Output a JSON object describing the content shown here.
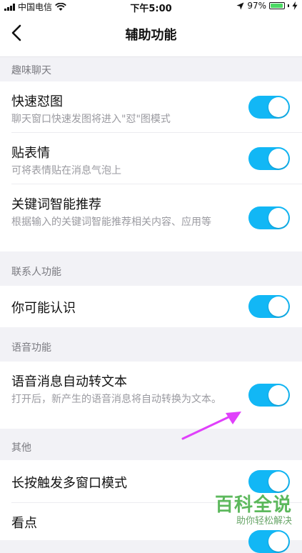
{
  "status_bar": {
    "carrier": "中国电信",
    "time": "下午5:00",
    "battery": "97%",
    "battery_level": 0.97
  },
  "nav": {
    "title": "辅助功能"
  },
  "sections": [
    {
      "header": "趣味聊天",
      "items": [
        {
          "title": "快速怼图",
          "subtitle": "聊天窗口快速发图将进入\"怼\"图模式",
          "enabled": true
        },
        {
          "title": "贴表情",
          "subtitle": "可将表情贴在消息气泡上",
          "enabled": true
        },
        {
          "title": "关键词智能推荐",
          "subtitle": "根据输入的关键词智能推荐相关内容、应用等",
          "enabled": true
        }
      ]
    },
    {
      "header": "联系人功能",
      "items": [
        {
          "title": "你可能认识",
          "enabled": true
        }
      ]
    },
    {
      "header": "语音功能",
      "items": [
        {
          "title": "语音消息自动转文本",
          "subtitle": "打开后，新产生的语音消息将自动转换为文本。",
          "enabled": true
        }
      ]
    },
    {
      "header": "其他",
      "items": [
        {
          "title": "长按触发多窗口模式",
          "enabled": true
        },
        {
          "title": "看点",
          "enabled": true
        }
      ]
    }
  ],
  "watermark": {
    "main": "百科全说",
    "sub": "助你轻松解决"
  },
  "colors": {
    "toggle_on": "#12b7f5",
    "background": "#f2f2f6",
    "arrow": "#e040fb"
  }
}
